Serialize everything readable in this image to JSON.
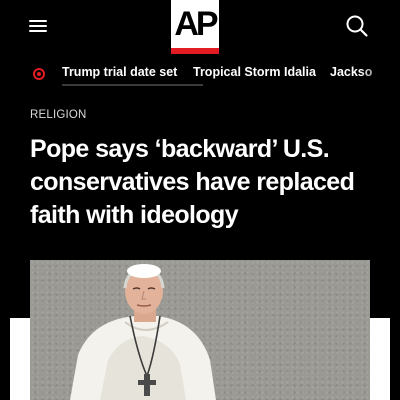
{
  "header": {
    "logo_text": "AP",
    "menu_icon": "hamburger-menu-icon",
    "search_icon": "search-icon",
    "logo_bar_color": "#e31b23"
  },
  "trending": {
    "live_icon": "live-dot-icon",
    "items": [
      {
        "label": "Trump trial date set"
      },
      {
        "label": "Tropical Storm Idalia"
      },
      {
        "label": "Jackso"
      }
    ]
  },
  "article": {
    "section": "RELIGION",
    "headline": "Pope says ‘backward’ U.S. conservatives have replaced faith with ideology"
  },
  "colors": {
    "background": "#000000",
    "accent": "#e31b23",
    "text": "#ffffff"
  }
}
